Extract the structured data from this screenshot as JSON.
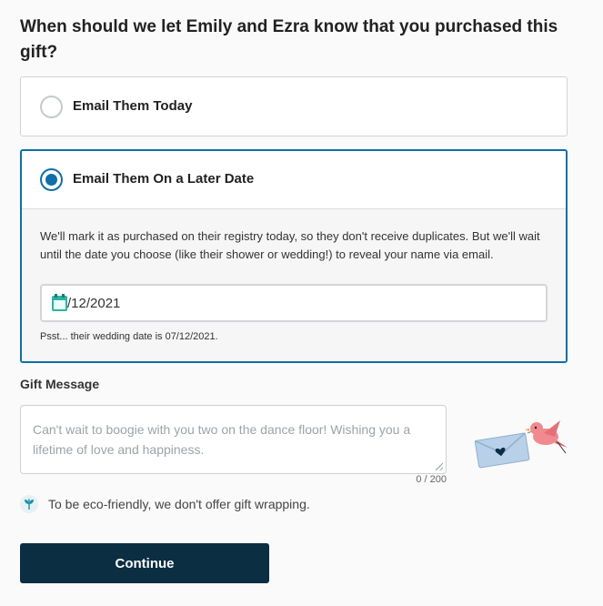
{
  "question": "When should we let Emily and Ezra know that you purchased this gift?",
  "options": [
    {
      "label": "Email Them Today",
      "selected": false
    },
    {
      "label": "Email Them On a Later Date",
      "selected": true
    }
  ],
  "later_date": {
    "description": "We'll mark it as purchased on their registry today, so they don't receive duplicates. But we'll wait until the date you choose (like their shower or wedding!) to reveal your name via email.",
    "date_value": "/12/2021",
    "wedding_note": "Psst... their wedding date is 07/12/2021."
  },
  "gift_message": {
    "label": "Gift Message",
    "placeholder": "Can't wait to boogie with you two on the dance floor! Wishing you a lifetime of love and happiness.",
    "char_count": "0 / 200"
  },
  "eco_note": "To be eco-friendly, we don't offer gift wrapping.",
  "continue_label": "Continue",
  "icons": {
    "calendar": "calendar-icon",
    "leaf": "leaf-icon",
    "illustration": "envelope-bird-illustration"
  },
  "colors": {
    "selected_accent": "#0f6fa6",
    "button_bg": "#0b2e43",
    "calendar_teal": "#2bb3a3",
    "envelope_blue": "#b8d0e8",
    "bird_pink": "#f08a8e"
  }
}
